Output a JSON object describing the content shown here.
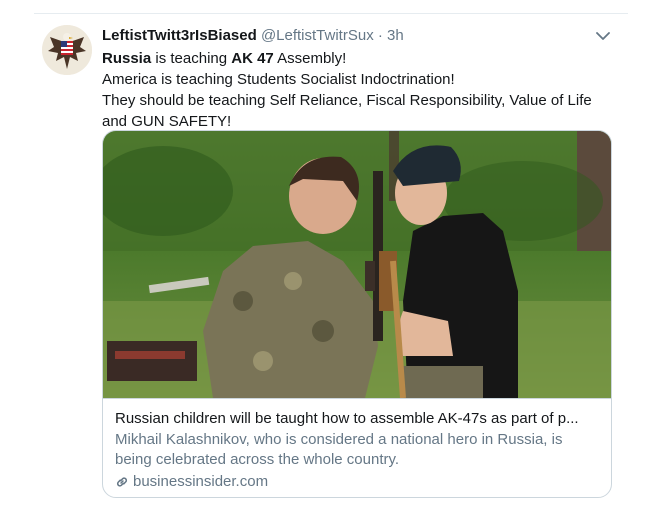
{
  "tweet": {
    "display_name": "LeftistTwitt3rIsBiased",
    "handle": "@LeftistTwitrSux",
    "separator": "·",
    "time": "3h",
    "line1": {
      "bold1": "Russia",
      "text1": " is teaching ",
      "bold2": "AK 47",
      "text2": " Assembly!"
    },
    "line2": "America is teaching Students Socialist Indoctrination!",
    "line3": "They should be teaching Self Reliance, Fiscal Responsibility, Value of Life",
    "line4": "and GUN SAFETY!"
  },
  "card": {
    "title": "Russian children will be taught how to assemble AK-47s as part of p...",
    "description": "Mikhail Kalashnikov, who is considered a national hero in Russia, is being celebrated across the whole country.",
    "domain": "businessinsider.com"
  },
  "icons": {
    "avatar": "eagle-flag-avatar",
    "menu": "chevron-down-icon",
    "domain": "link-icon"
  },
  "colors": {
    "text": "#14171a",
    "secondary": "#657786",
    "border": "#ccd6dd"
  }
}
